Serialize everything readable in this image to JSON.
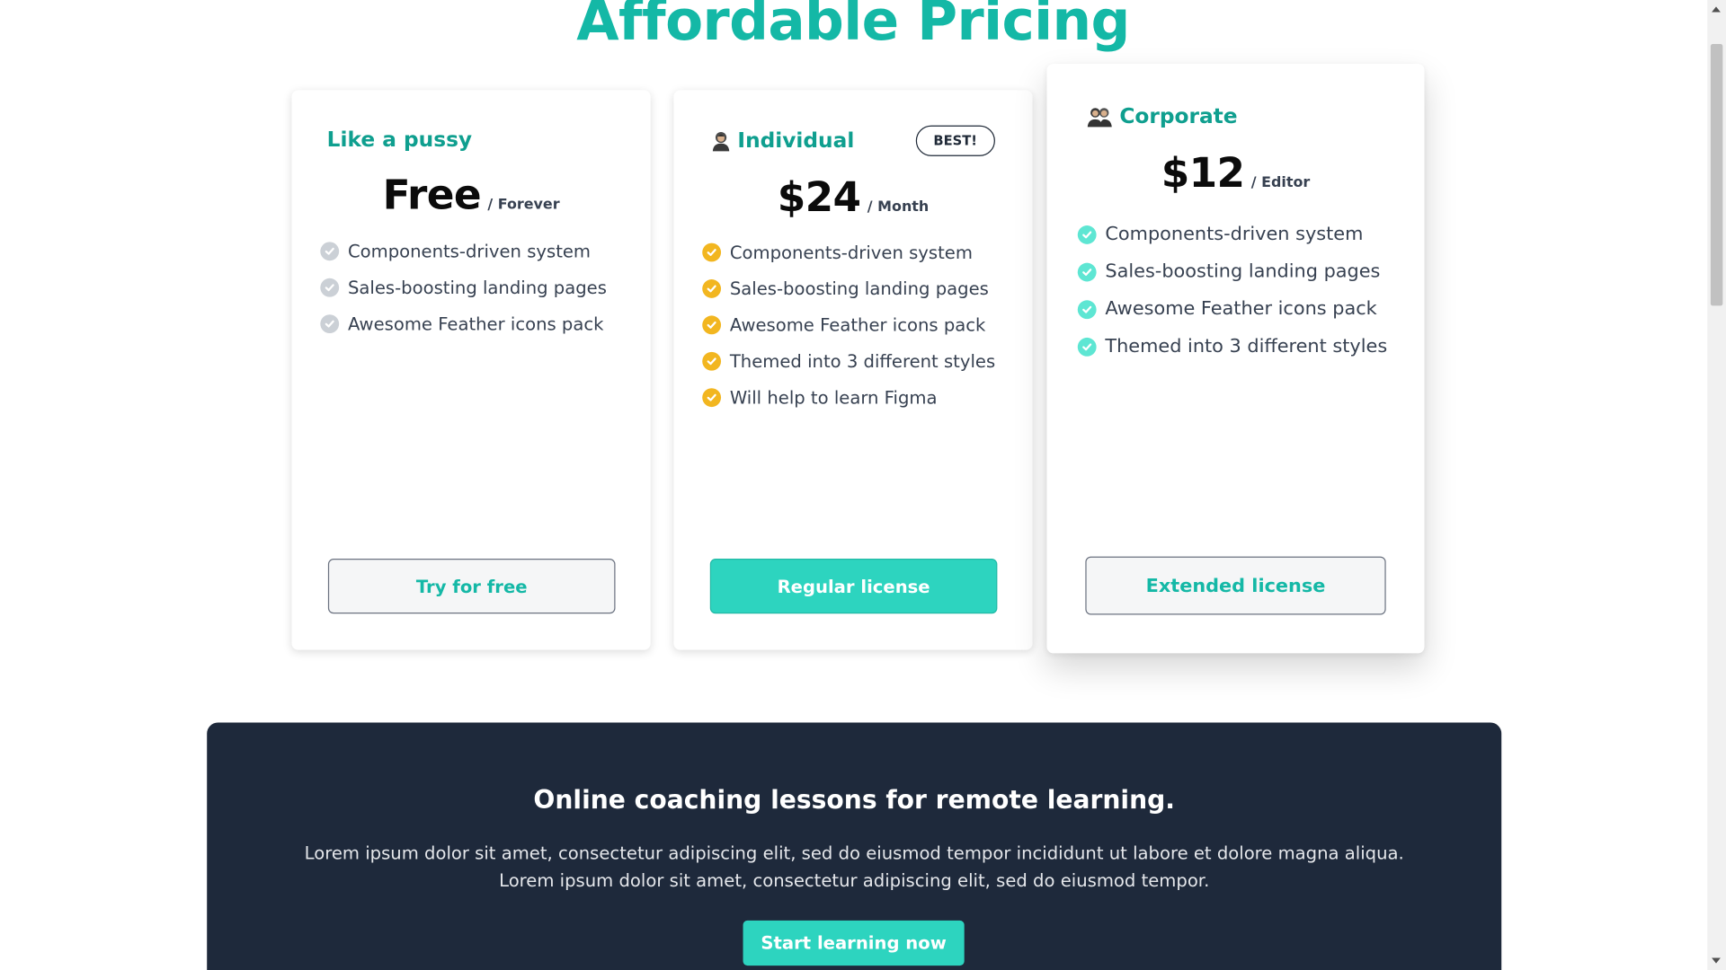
{
  "title": "Affordable Pricing",
  "colors": {
    "accent": "#14b8a6",
    "accent_filled": "#2dd4bf",
    "check_gray": "#cbd0d6",
    "check_gold": "#f2b620",
    "check_teal": "#5ee6d3",
    "dark_panel": "#1e293b"
  },
  "plans": [
    {
      "name": "Like a pussy",
      "price": "Free",
      "period": "/ Forever",
      "features": [
        "Components-driven system",
        "Sales-boosting landing pages",
        "Awesome Feather icons pack"
      ],
      "button": "Try for free"
    },
    {
      "name": "Individual",
      "icon": "person-icon",
      "badge": "BEST!",
      "price": "$24",
      "period": "/ Month",
      "features": [
        "Components-driven system",
        "Sales-boosting landing pages",
        "Awesome Feather icons pack",
        "Themed into 3 different styles",
        "Will help to learn Figma"
      ],
      "button": "Regular license"
    },
    {
      "name": "Corporate",
      "icon": "group-icon",
      "price": "$12",
      "period": "/ Editor",
      "features": [
        "Components-driven system",
        "Sales-boosting landing pages",
        "Awesome Feather icons pack",
        "Themed into 3 different styles"
      ],
      "button": "Extended license"
    }
  ],
  "cta": {
    "title": "Online coaching lessons for remote learning.",
    "line1": "Lorem ipsum dolor sit amet, consectetur adipiscing elit, sed do eiusmod tempor incididunt ut labore et dolore magna aliqua.",
    "line2": "Lorem ipsum dolor sit amet, consectetur adipiscing elit, sed do eiusmod tempor.",
    "button": "Start learning now"
  }
}
